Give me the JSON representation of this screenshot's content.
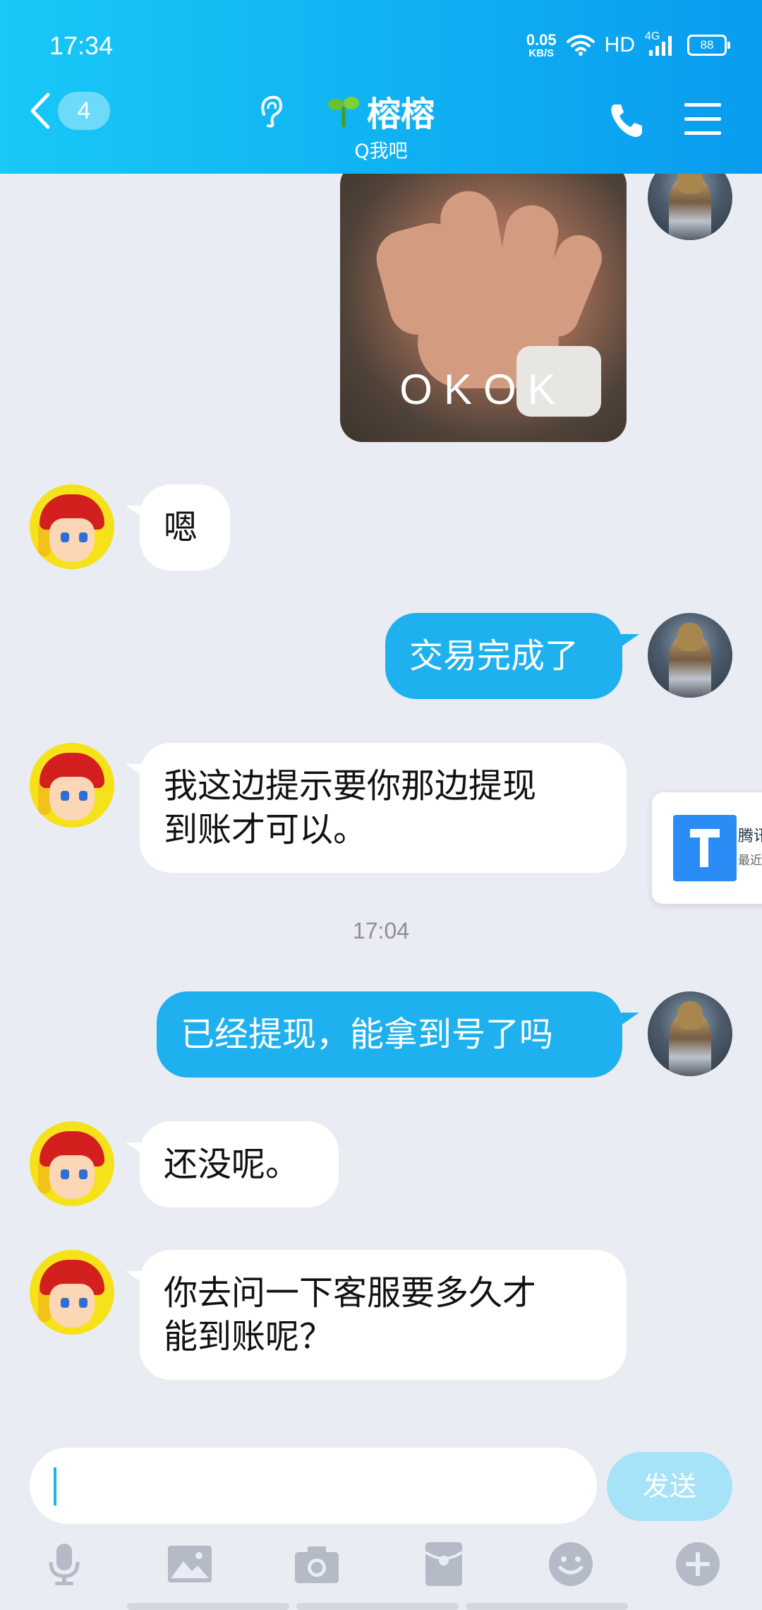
{
  "status_bar": {
    "time": "17:34",
    "net_speed_value": "0.05",
    "net_speed_unit": "KB/S",
    "hd": "HD",
    "signal_type": "4G",
    "battery": "88"
  },
  "header": {
    "back_count": "4",
    "contact_name": "榕榕",
    "subtitle": "Q我吧"
  },
  "messages": {
    "sticker_text": "OKOK",
    "m1": "嗯",
    "m2": "交易完成了",
    "m3_line1": "我这边提示要你那边提现",
    "m3_line2": "到账才可以。",
    "timestamp": "17:04",
    "m4": "已经提现，能拿到号了吗",
    "m5": "还没呢。",
    "m6_line1": "你去问一下客服要多久才",
    "m6_line2": "能到账呢？"
  },
  "float_card": {
    "title": "腾讯",
    "subtitle": "最近"
  },
  "input": {
    "value": "",
    "send_label": "发送"
  },
  "colors": {
    "header_start": "#18c8f7",
    "header_end": "#0a9cee",
    "outgoing_bubble": "#1fb1ef",
    "chat_background": "#e9ecf3"
  }
}
